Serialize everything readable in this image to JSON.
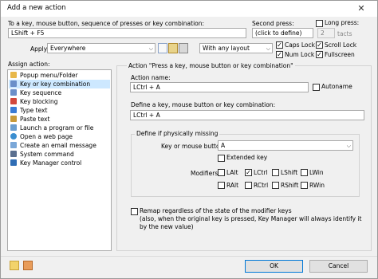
{
  "window": {
    "title": "Add a new action",
    "close_glyph": "✕"
  },
  "trigger": {
    "label": "To a key, mouse button, sequence of presses or key combination:",
    "value": "LShift + F5"
  },
  "second_press": {
    "label": "Second press:",
    "value": "(click to define)"
  },
  "long_press": {
    "label": "Long press:",
    "value": "2",
    "unit": "tacts",
    "checked": false
  },
  "apply": {
    "label": "Apply",
    "value": "Everywhere",
    "layout_value": "With any layout"
  },
  "locks": {
    "caps_lock": {
      "label": "Caps Lock",
      "checked": true
    },
    "scroll_lock": {
      "label": "Scroll Lock",
      "checked": true
    },
    "num_lock": {
      "label": "Num Lock",
      "checked": true
    },
    "fullscreen": {
      "label": "Fullscreen",
      "checked": true
    }
  },
  "assign": {
    "label": "Assign action:",
    "items": [
      {
        "label": "Popup menu/Folder",
        "icon_color": "#e8b84a"
      },
      {
        "label": "Key or key combination",
        "icon_color": "#6b8fc9"
      },
      {
        "label": "Key sequence",
        "icon_color": "#6b8fc9"
      },
      {
        "label": "Key blocking",
        "icon_color": "#d2473c"
      },
      {
        "label": "Type text",
        "icon_color": "#3a7bd5"
      },
      {
        "label": "Paste text",
        "icon_color": "#c89a3a"
      },
      {
        "label": "Launch a program or file",
        "icon_color": "#6a9ecf"
      },
      {
        "label": "Open a web page",
        "icon_color": "#3a8ed0"
      },
      {
        "label": "Create an email message",
        "icon_color": "#7aa7d8"
      },
      {
        "label": "System command",
        "icon_color": "#5a6f8f"
      },
      {
        "label": "Key Manager control",
        "icon_color": "#2f6db5"
      }
    ]
  },
  "action_panel": {
    "header": "Action \"Press a key, mouse button or key combination\"",
    "name_label": "Action name:",
    "name_value": "LCtrl + A",
    "autoname_label": "Autoname",
    "autoname_checked": false,
    "define_label": "Define a key, mouse button or key combination:",
    "define_value": "LCtrl + A",
    "missing_group": "Define if physically missing",
    "key_label": "Key or mouse button",
    "key_value": "A",
    "extended_label": "Extended key",
    "modifiers_label": "Modifiers",
    "modifiers": [
      {
        "label": "LAlt",
        "checked": false
      },
      {
        "label": "LCtrl",
        "checked": true
      },
      {
        "label": "LShift",
        "checked": false
      },
      {
        "label": "LWin",
        "checked": false
      },
      {
        "label": "RAlt",
        "checked": false
      },
      {
        "label": "RCtrl",
        "checked": false
      },
      {
        "label": "RShift",
        "checked": false
      },
      {
        "label": "RWin",
        "checked": false
      }
    ],
    "remap_label": "Remap regardless of the state of the modifier keys",
    "remap_note": "(also, when the original key is pressed, Key Manager will always identify it by the new value)",
    "remap_checked": false
  },
  "footer": {
    "ok_label": "OK",
    "cancel_label": "Cancel"
  }
}
